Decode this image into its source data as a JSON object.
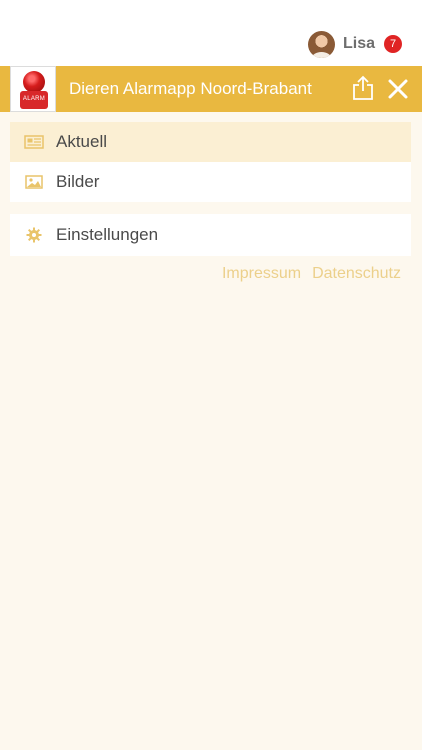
{
  "user": {
    "name": "Lisa",
    "badge_count": "7"
  },
  "header": {
    "title": "Dieren Alarmapp Noord-Brabant",
    "logo_text": "ALARM"
  },
  "menu": {
    "items": [
      {
        "label": "Aktuell",
        "icon": "newspaper-icon",
        "active": true
      },
      {
        "label": "Bilder",
        "icon": "image-icon",
        "active": false
      },
      {
        "label": "Einstellungen",
        "icon": "gear-icon",
        "active": false
      }
    ]
  },
  "footer": {
    "impressum": "Impressum",
    "datenschutz": "Datenschutz"
  },
  "colors": {
    "header": "#e9b840",
    "active_item": "#fbefd3",
    "background": "#fdf8ee",
    "badge": "#e02424",
    "link": "#ecd08b"
  }
}
